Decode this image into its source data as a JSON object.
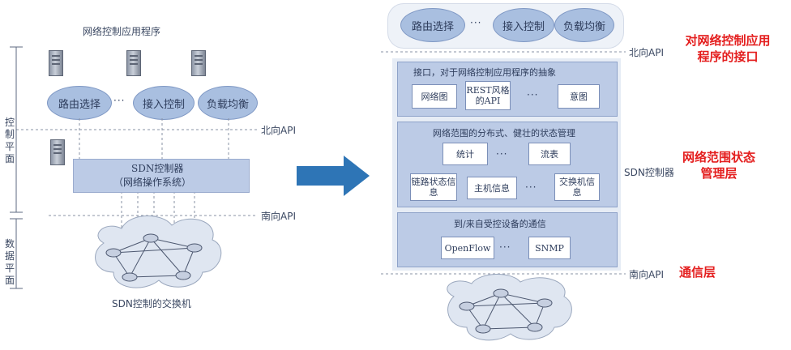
{
  "left": {
    "apps_title": "网络控制应用程序",
    "apps": [
      "路由选择",
      "接入控制",
      "负载均衡"
    ],
    "ellipsis": "···",
    "northbound": "北向API",
    "controller_line1": "SDN控制器",
    "controller_line2": "（网络操作系统）",
    "southbound": "南向API",
    "control_plane": "控制平面",
    "data_plane": "数据平面",
    "switches_caption": "SDN控制的交换机"
  },
  "right": {
    "apps": [
      "路由选择",
      "接入控制",
      "负载均衡"
    ],
    "ellipsis": "···",
    "northbound": "北向API",
    "southbound": "南向API",
    "controller_label": "SDN控制器",
    "layer1": {
      "title": "接口，对于网络控制应用程序的抽象",
      "boxes": [
        "网络图",
        "REST风格的API",
        "意图"
      ]
    },
    "layer2": {
      "title": "网络范围的分布式、健壮的状态管理",
      "boxes_top": [
        "统计",
        "流表"
      ],
      "boxes_bottom": [
        "链路状态信息",
        "主机信息",
        "交换机信息"
      ]
    },
    "layer3": {
      "title": "到/来自受控设备的通信",
      "boxes": [
        "OpenFlow",
        "SNMP"
      ]
    }
  },
  "annotations": {
    "top_line1": "对网络控制应用",
    "top_line2": "程序的接口",
    "mid_line1": "网络范围状态",
    "mid_line2": "管理层",
    "bottom": "通信层"
  },
  "colors": {
    "annotation": "#e41e1e",
    "arrow": "#2e75b6",
    "layer_fill": "#bccbe6"
  }
}
